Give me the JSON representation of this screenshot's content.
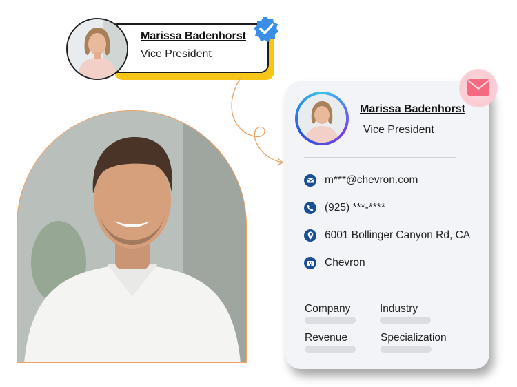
{
  "profile_tag": {
    "name": "Marissa Badenhorst",
    "title": "Vice President",
    "accent_color": "#f5c518",
    "verified_icon": "verified-badge-icon"
  },
  "card": {
    "name": "Marissa Badenhorst",
    "title": "Vice President",
    "mail_icon": "envelope-icon",
    "contact": [
      {
        "icon": "email-icon",
        "text": "m***@chevron.com"
      },
      {
        "icon": "phone-icon",
        "text": "(925) ***-****"
      },
      {
        "icon": "location-pin-icon",
        "text": "6001 Bollinger Canyon Rd, CA"
      },
      {
        "icon": "company-icon",
        "text": "Chevron"
      }
    ],
    "fields": [
      {
        "label": "Company"
      },
      {
        "label": "Industry"
      },
      {
        "label": "Revenue"
      },
      {
        "label": "Specialization"
      }
    ],
    "icon_color": "#1b4f93"
  },
  "colors": {
    "photo_border": "#f0a060",
    "connector": "#f0a060"
  }
}
